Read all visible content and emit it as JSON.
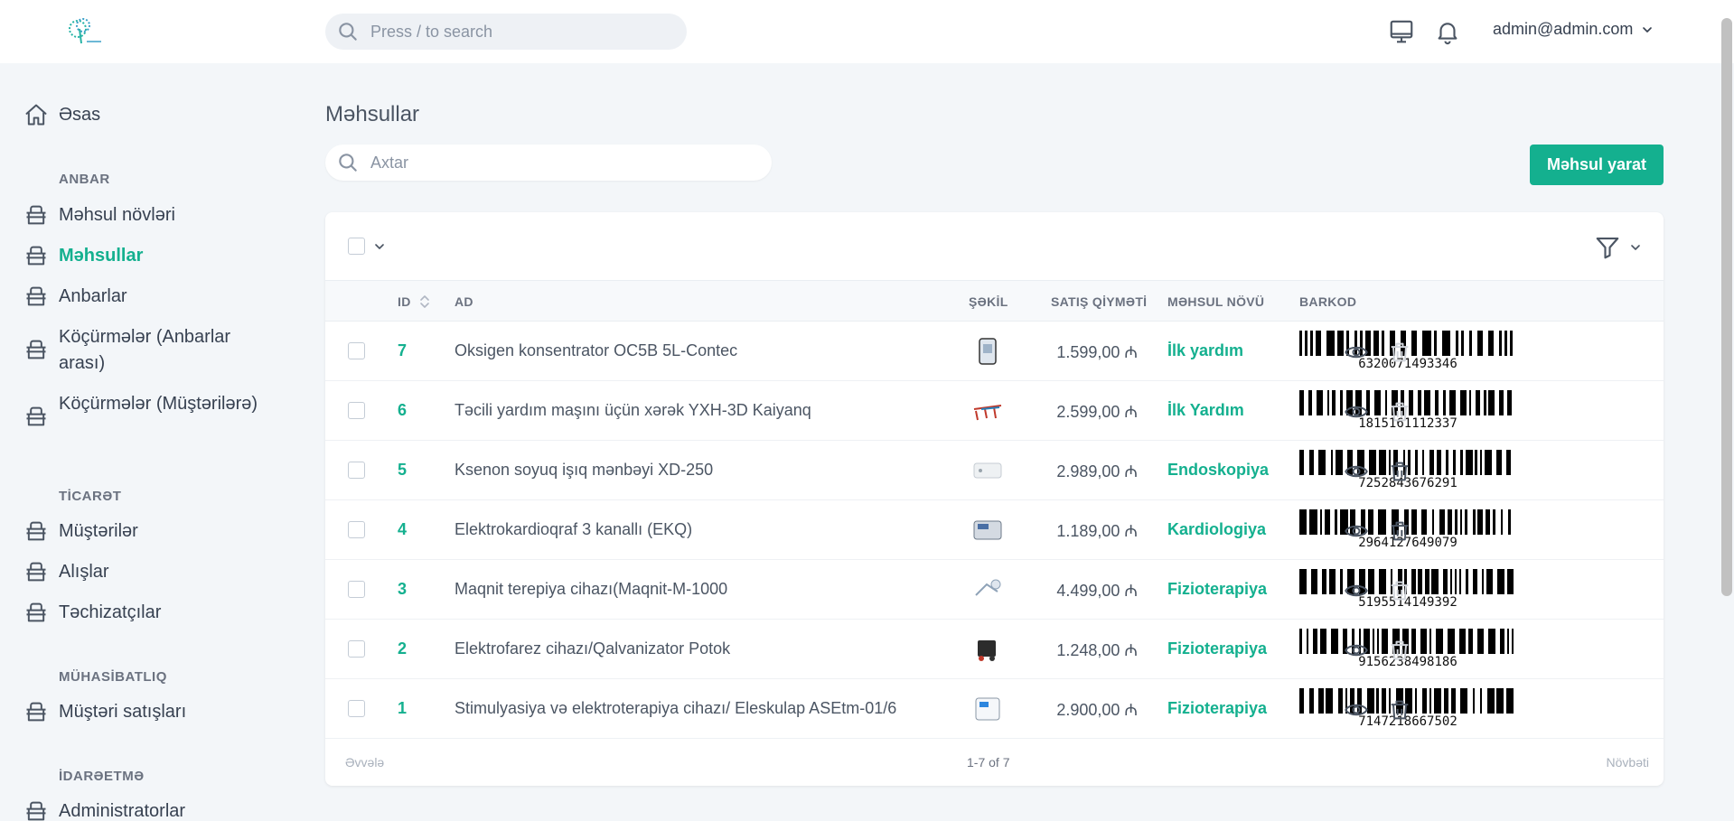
{
  "header": {
    "search_placeholder": "Press / to search",
    "user_email": "admin@admin.com"
  },
  "sidebar": {
    "home": "Əsas",
    "groups": [
      {
        "title": "ANBAR",
        "items": [
          "Məhsul növləri",
          "Məhsullar",
          "Anbarlar",
          "Köçürmələr (Anbarlar arası)",
          "Köçürmələr (Müştərilərə)"
        ]
      },
      {
        "title": "TİCARƏT",
        "items": [
          "Müştərilər",
          "Alışlar",
          "Təchizatçılar"
        ]
      },
      {
        "title": "MÜHASİBATLIQ",
        "items": [
          "Müştəri satışları"
        ]
      },
      {
        "title": "İDARƏETMƏ",
        "items": [
          "Administratorlar"
        ]
      }
    ],
    "active_item": "Məhsullar"
  },
  "main": {
    "title": "Məhsullar",
    "search_placeholder": "Axtar",
    "create_button": "Məhsul yarat",
    "columns": [
      "ID",
      "AD",
      "ŞƏKİL",
      "SATIŞ QİYMƏTİ",
      "MƏHSUL NÖVÜ",
      "BARKOD"
    ],
    "rows": [
      {
        "id": "7",
        "name": "Oksigen konsentrator OC5B 5L-Contec",
        "price": "1.599,00 ₼",
        "category": "İlk yardım",
        "barcode": "6320071493346",
        "delete_enabled": false
      },
      {
        "id": "6",
        "name": "Təcili yardım maşını üçün xərək YXH-3D Kaiyanq",
        "price": "2.599,00 ₼",
        "category": "İlk Yardım",
        "barcode": "1815161112337",
        "delete_enabled": false
      },
      {
        "id": "5",
        "name": "Ksenon soyuq işıq mənbəyi XD-250",
        "price": "2.989,00 ₼",
        "category": "Endoskopiya",
        "barcode": "7252843676291",
        "delete_enabled": true
      },
      {
        "id": "4",
        "name": "Elektrokardioqraf 3 kanallı (EKQ)",
        "price": "1.189,00 ₼",
        "category": "Kardiologiya",
        "barcode": "2964127649079",
        "delete_enabled": true
      },
      {
        "id": "3",
        "name": "Maqnit terepiya cihazı(Maqnit-M-1000",
        "price": "4.499,00 ₼",
        "category": "Fizioterapiya",
        "barcode": "5195514149392",
        "delete_enabled": false
      },
      {
        "id": "2",
        "name": "Elektrofarez cihazı/Qalvanizator Potok",
        "price": "1.248,00 ₼",
        "category": "Fizioterapiya",
        "barcode": "9156238498186",
        "delete_enabled": false
      },
      {
        "id": "1",
        "name": "Stimulyasiya və elektroterapiya cihazı/ Eleskulap ASEtm-01/6",
        "price": "2.900,00 ₼",
        "category": "Fizioterapiya",
        "barcode": "7147218667502",
        "delete_enabled": true
      }
    ],
    "pagination": {
      "prev": "Əvvələ",
      "range": "1-7 of 7",
      "next": "Növbəti"
    }
  },
  "colors": {
    "accent": "#14b08f",
    "text": "#374151",
    "muted": "#6b7280",
    "background": "#f3f6f9"
  },
  "icons": [
    "search-icon",
    "monitor-icon",
    "bell-icon",
    "chevron-down-icon",
    "home-icon",
    "box-icon",
    "filter-icon",
    "sort-icon",
    "eye-icon",
    "trash-icon"
  ]
}
